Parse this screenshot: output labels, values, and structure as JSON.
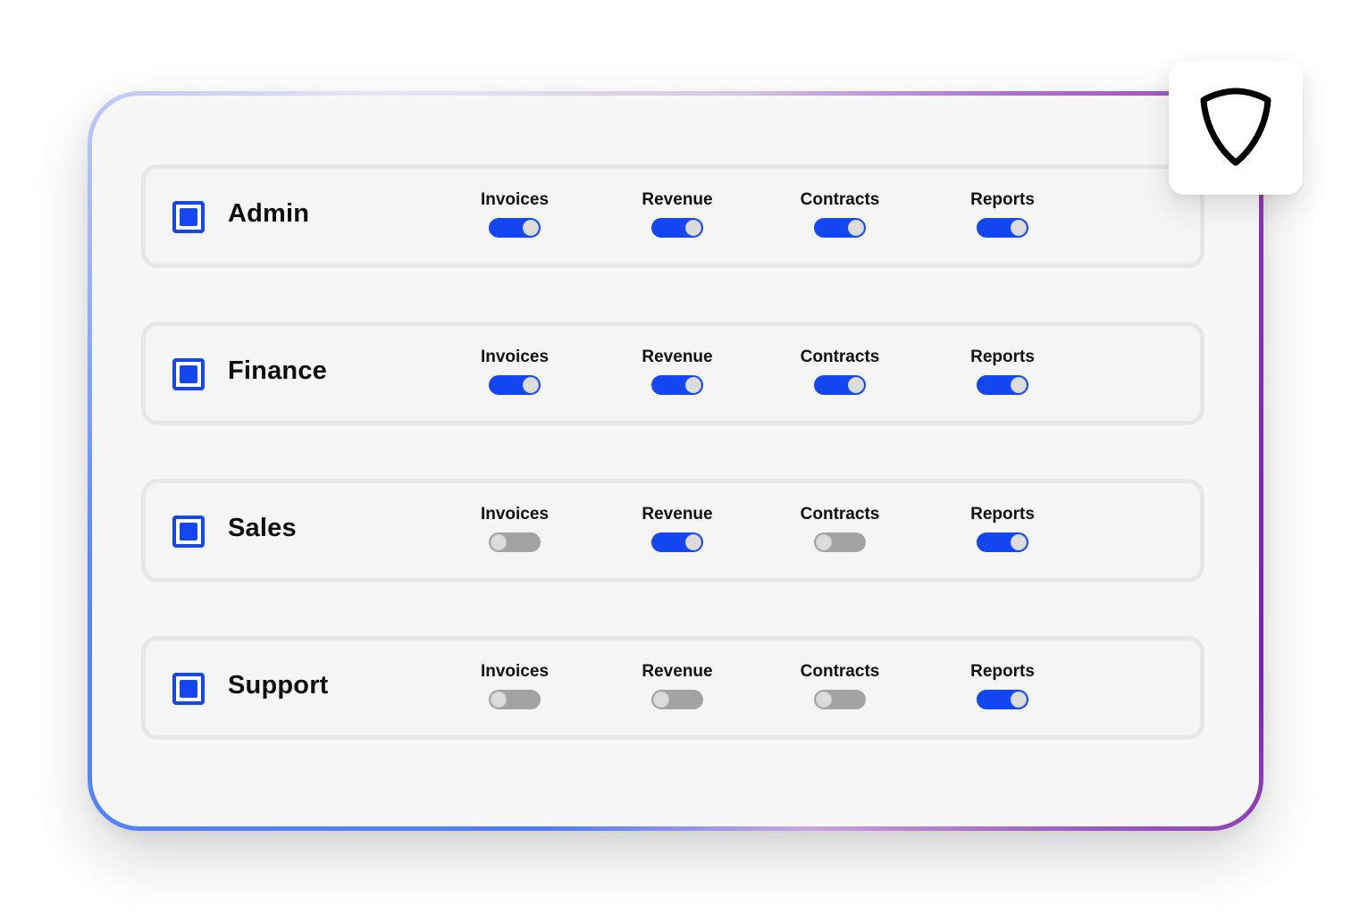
{
  "accent_color": "#1446f2",
  "off_color": "#a3a3a3",
  "shield": {
    "icon": "shield-icon"
  },
  "roles": [
    {
      "name": "Admin",
      "checked": true,
      "permissions": [
        {
          "label": "Invoices",
          "enabled": true
        },
        {
          "label": "Revenue",
          "enabled": true
        },
        {
          "label": "Contracts",
          "enabled": true
        },
        {
          "label": "Reports",
          "enabled": true
        }
      ]
    },
    {
      "name": "Finance",
      "checked": true,
      "permissions": [
        {
          "label": "Invoices",
          "enabled": true
        },
        {
          "label": "Revenue",
          "enabled": true
        },
        {
          "label": "Contracts",
          "enabled": true
        },
        {
          "label": "Reports",
          "enabled": true
        }
      ]
    },
    {
      "name": "Sales",
      "checked": true,
      "permissions": [
        {
          "label": "Invoices",
          "enabled": false
        },
        {
          "label": "Revenue",
          "enabled": true
        },
        {
          "label": "Contracts",
          "enabled": false
        },
        {
          "label": "Reports",
          "enabled": true
        }
      ]
    },
    {
      "name": "Support",
      "checked": true,
      "permissions": [
        {
          "label": "Invoices",
          "enabled": false
        },
        {
          "label": "Revenue",
          "enabled": false
        },
        {
          "label": "Contracts",
          "enabled": false
        },
        {
          "label": "Reports",
          "enabled": true
        }
      ]
    }
  ]
}
